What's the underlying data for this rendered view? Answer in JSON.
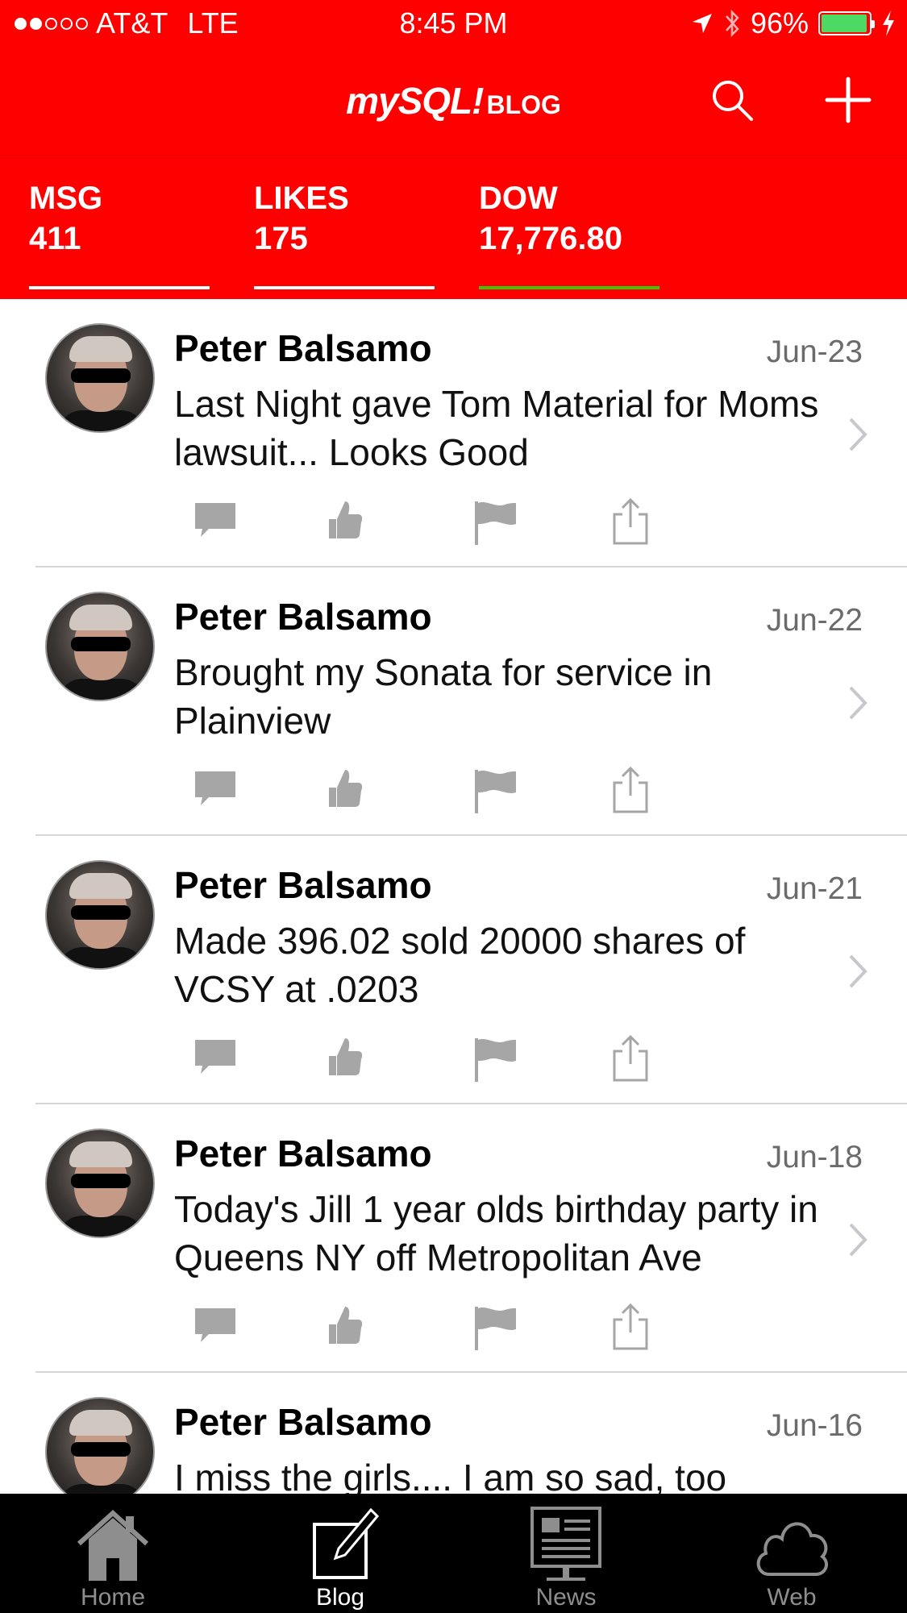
{
  "status_bar": {
    "carrier": "AT&T",
    "network": "LTE",
    "time": "8:45 PM",
    "battery": "96%",
    "battery_level": 0.96,
    "signal_bars_filled": 2,
    "signal_bars_total": 5
  },
  "nav": {
    "brand_main": "mySQL!",
    "brand_sub": "BLOG",
    "search_icon": "search-icon",
    "add_icon": "plus-icon"
  },
  "stats": [
    {
      "label": "MSG",
      "value": "411"
    },
    {
      "label": "LIKES",
      "value": "175"
    },
    {
      "label": "DOW",
      "value": "17,776.80"
    }
  ],
  "colors": {
    "accent": "#fe0000",
    "dow_underline": "#39c700",
    "icon_gray": "#a6a6a6",
    "tabbar": "#000000"
  },
  "posts": [
    {
      "author": "Peter Balsamo",
      "date": "Jun-23",
      "text": "Last Night gave Tom Material for Moms lawsuit... Looks Good"
    },
    {
      "author": "Peter Balsamo",
      "date": "Jun-22",
      "text": "Brought my Sonata for service in Plainview"
    },
    {
      "author": "Peter Balsamo",
      "date": "Jun-21",
      "text": "Made 396.02 sold 20000 shares of VCSY at .0203"
    },
    {
      "author": "Peter Balsamo",
      "date": "Jun-18",
      "text": "Today's Jill 1 year olds birthday party in Queens NY off Metropolitan Ave"
    },
    {
      "author": "Peter Balsamo",
      "date": "Jun-16",
      "text": "I miss the girls.... I am so sad, too"
    }
  ],
  "tabs": [
    {
      "label": "Home",
      "icon": "home-icon"
    },
    {
      "label": "Blog",
      "icon": "blog-icon",
      "active": true
    },
    {
      "label": "News",
      "icon": "news-icon"
    },
    {
      "label": "Web",
      "icon": "cloud-icon"
    }
  ]
}
